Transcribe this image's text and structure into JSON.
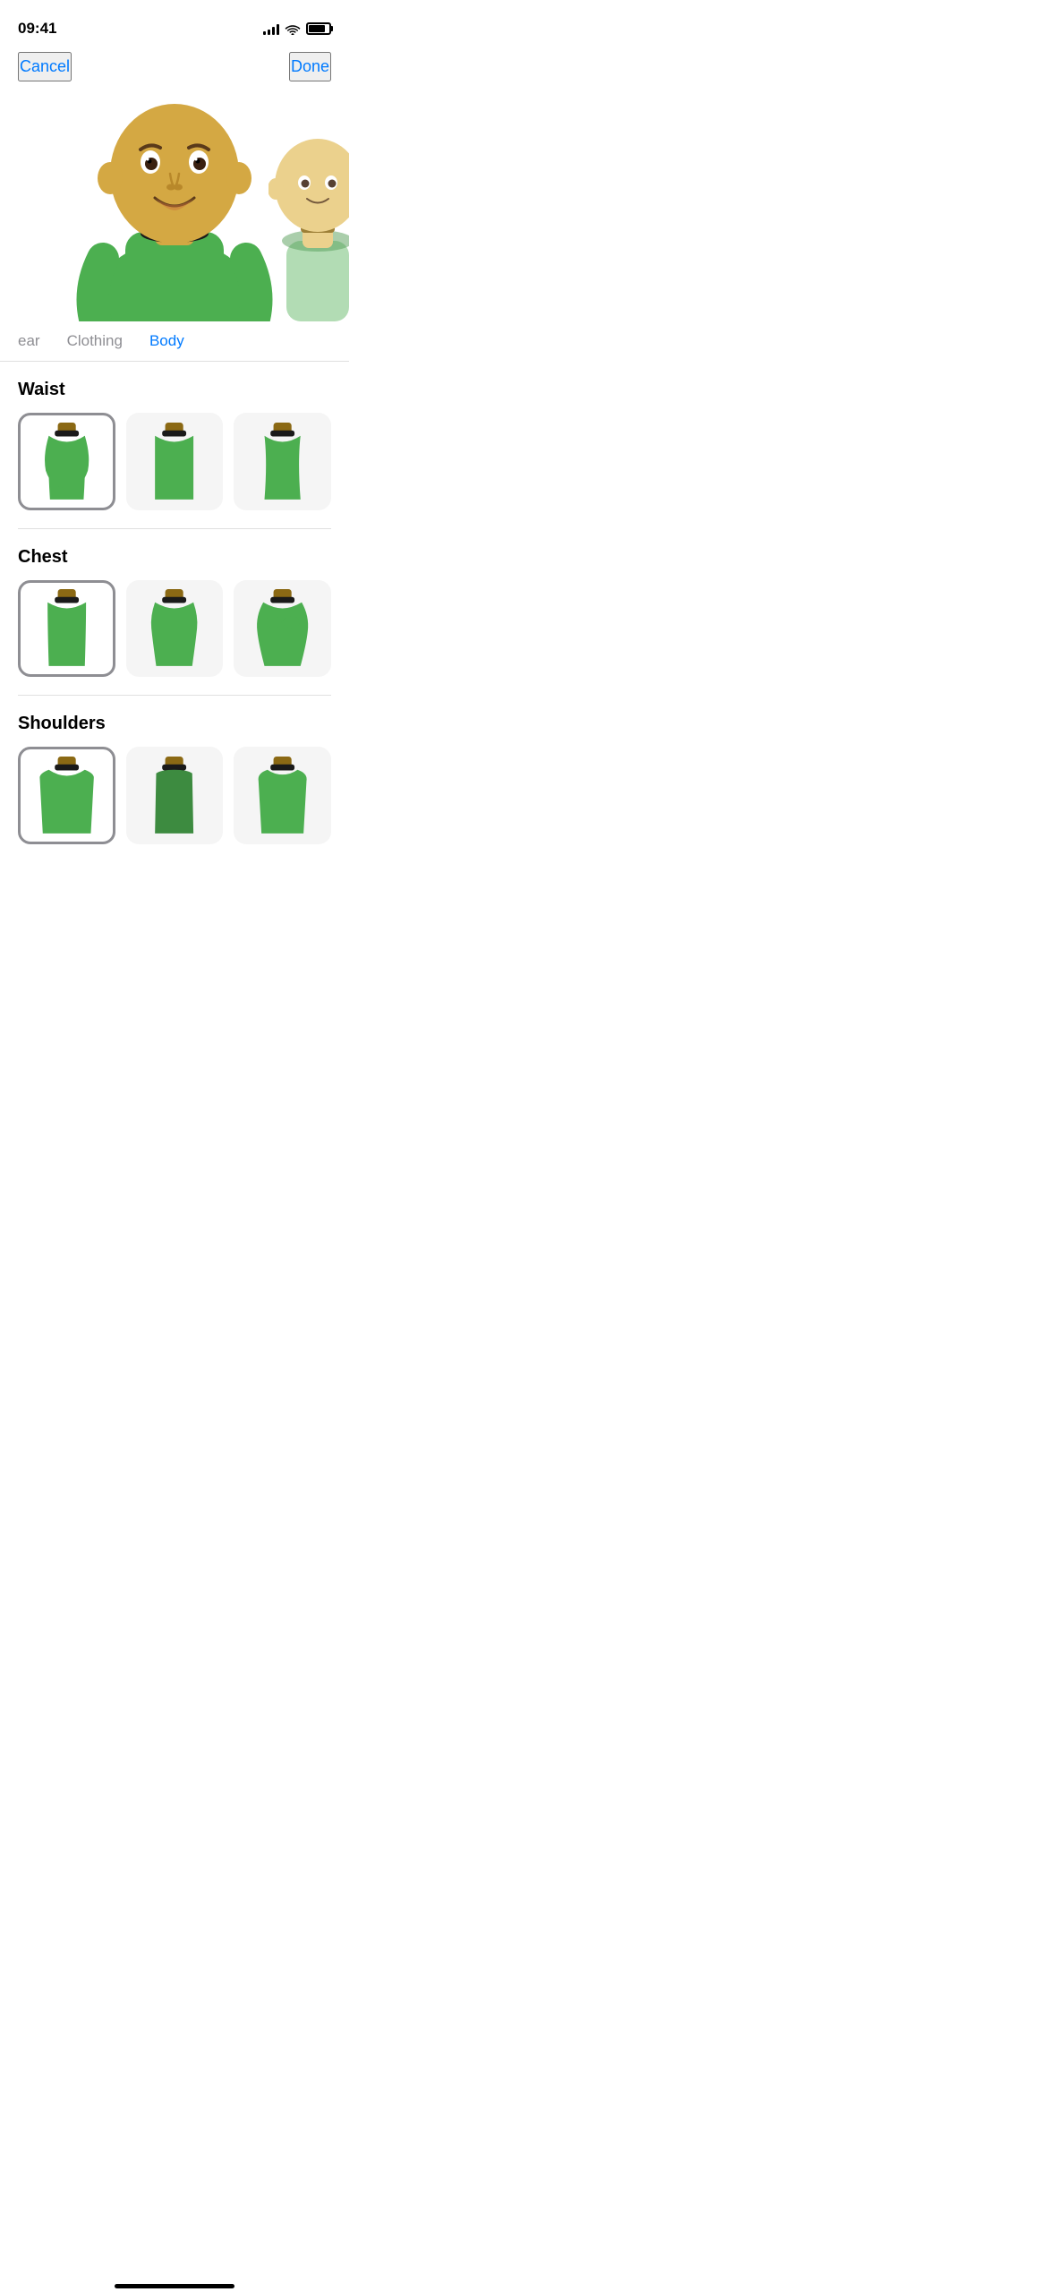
{
  "statusBar": {
    "time": "09:41"
  },
  "nav": {
    "cancel": "Cancel",
    "done": "Done"
  },
  "tabs": [
    {
      "id": "headwear",
      "label": "ear",
      "active": false,
      "partial": true
    },
    {
      "id": "clothing",
      "label": "Clothing",
      "active": false
    },
    {
      "id": "body",
      "label": "Body",
      "active": true
    }
  ],
  "sections": [
    {
      "id": "waist",
      "title": "Waist",
      "options": [
        {
          "id": "waist-1",
          "selected": true
        },
        {
          "id": "waist-2",
          "selected": false
        },
        {
          "id": "waist-3",
          "selected": false
        }
      ]
    },
    {
      "id": "chest",
      "title": "Chest",
      "options": [
        {
          "id": "chest-1",
          "selected": true
        },
        {
          "id": "chest-2",
          "selected": false
        },
        {
          "id": "chest-3",
          "selected": false
        }
      ]
    },
    {
      "id": "shoulders",
      "title": "Shoulders",
      "options": [
        {
          "id": "shoulders-1",
          "selected": true
        },
        {
          "id": "shoulders-2",
          "selected": false
        },
        {
          "id": "shoulders-3",
          "selected": false
        }
      ]
    }
  ],
  "colors": {
    "green": "#4CAF50",
    "greenDark": "#43A047",
    "greenLight": "#81C784",
    "skin": "#D4A843",
    "collar": "#1a1a1a",
    "neckBrown": "#8B6914",
    "blue": "#007AFF"
  }
}
